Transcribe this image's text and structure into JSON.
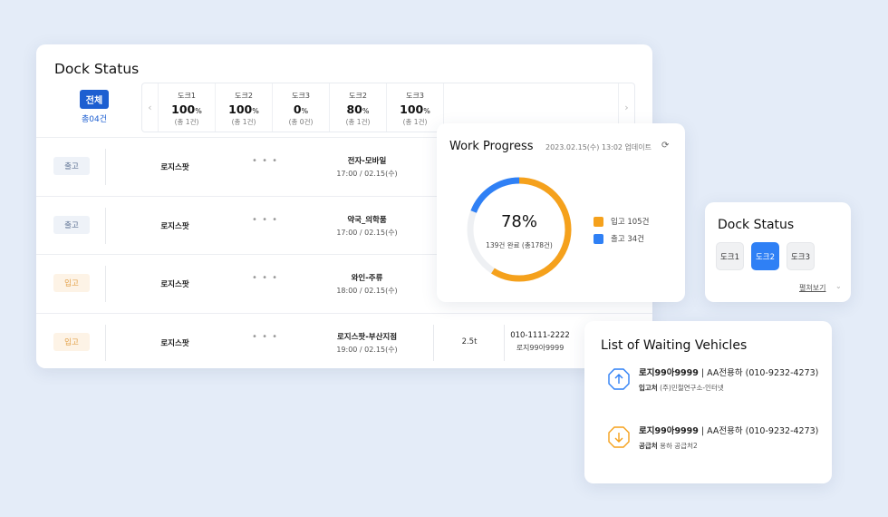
{
  "main": {
    "title": "Dock Status",
    "all_label": "전체",
    "all_count": "총04건",
    "docks": [
      {
        "name": "도크1",
        "pct": "100",
        "unit": "%",
        "total": "(총 1건)"
      },
      {
        "name": "도크2",
        "pct": "100",
        "unit": "%",
        "total": "(총 1건)"
      },
      {
        "name": "도크3",
        "pct": "0",
        "unit": "%",
        "total": "(총 0건)"
      },
      {
        "name": "도크2",
        "pct": "80",
        "unit": "%",
        "total": "(총 1건)"
      },
      {
        "name": "도크3",
        "pct": "100",
        "unit": "%",
        "total": "(총 1건)"
      }
    ],
    "rows": [
      {
        "type": "출고",
        "kind": "out",
        "company": "로지스팟",
        "more": "• • •",
        "cargo": "전자-모바일",
        "time": "17:00 / 02.15(수)",
        "tonnage": "",
        "phone": "",
        "plate": ""
      },
      {
        "type": "출고",
        "kind": "out",
        "company": "로지스팟",
        "more": "• • •",
        "cargo": "약국_의학품",
        "time": "17:00 / 02.15(수)",
        "tonnage": "",
        "phone": "",
        "plate": ""
      },
      {
        "type": "입고",
        "kind": "in",
        "company": "로지스팟",
        "more": "• • •",
        "cargo": "와인-주류",
        "time": "18:00 / 02.15(수)",
        "tonnage": "",
        "phone": "",
        "plate": ""
      },
      {
        "type": "입고",
        "kind": "in",
        "company": "로지스팟",
        "more": "• • •",
        "cargo": "로지스팟-부산지점",
        "time": "19:00 / 02.15(수)",
        "tonnage": "2.5t",
        "phone": "010-1111-2222",
        "plate": "로지99아9999"
      }
    ]
  },
  "progress": {
    "title": "Work Progress",
    "updated": "2023.02.15(수) 13:02 업데이트",
    "percent": "78%",
    "summary": "139건 완료 (총178건)",
    "legend": [
      {
        "label": "입고 105건",
        "color": "#f5a11c"
      },
      {
        "label": "출고 34건",
        "color": "#2f80f5"
      }
    ],
    "inbound_count": 105,
    "outbound_count": 34,
    "total_count": 178
  },
  "dock_small": {
    "title": "Dock Status",
    "buttons": [
      "도크1",
      "도크2",
      "도크3"
    ],
    "active_index": 1,
    "more_label": "펼쳐보기"
  },
  "waiting": {
    "title": "List of Waiting Vehicles",
    "vehicles": [
      {
        "direction": "up",
        "icon_color": "#2f80f5",
        "plate": "로지99아9999",
        "detail": " | AA전용하 (010-9232-4273)",
        "sub_label": "입고처",
        "sub_value": " (주)민철연구소-인터넷"
      },
      {
        "direction": "down",
        "icon_color": "#f5a11c",
        "plate": "로지99아9999",
        "detail": " | AA전용하 (010-9232-4273)",
        "sub_label": "공급처",
        "sub_value": " 용하 공급처2"
      }
    ]
  }
}
